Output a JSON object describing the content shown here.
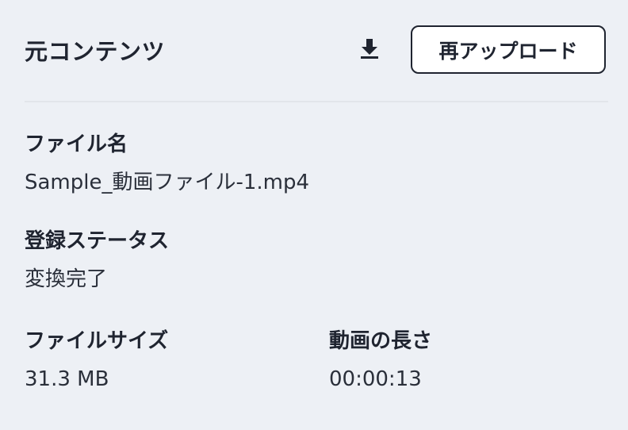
{
  "header": {
    "title": "元コンテンツ",
    "download_icon": "download-icon",
    "reupload_label": "再アップロード"
  },
  "fields": {
    "file_name": {
      "label": "ファイル名",
      "value": "Sample_動画ファイル-1.mp4"
    },
    "registration_status": {
      "label": "登録ステータス",
      "value": "変換完了"
    },
    "file_size": {
      "label": "ファイルサイズ",
      "value": "31.3 MB"
    },
    "video_length": {
      "label": "動画の長さ",
      "value": "00:00:13"
    }
  },
  "colors": {
    "background": "#edf0f5",
    "text": "#1f2430",
    "button_border": "#1f2430",
    "button_background": "#ffffff",
    "divider": "#e2e5ea"
  }
}
